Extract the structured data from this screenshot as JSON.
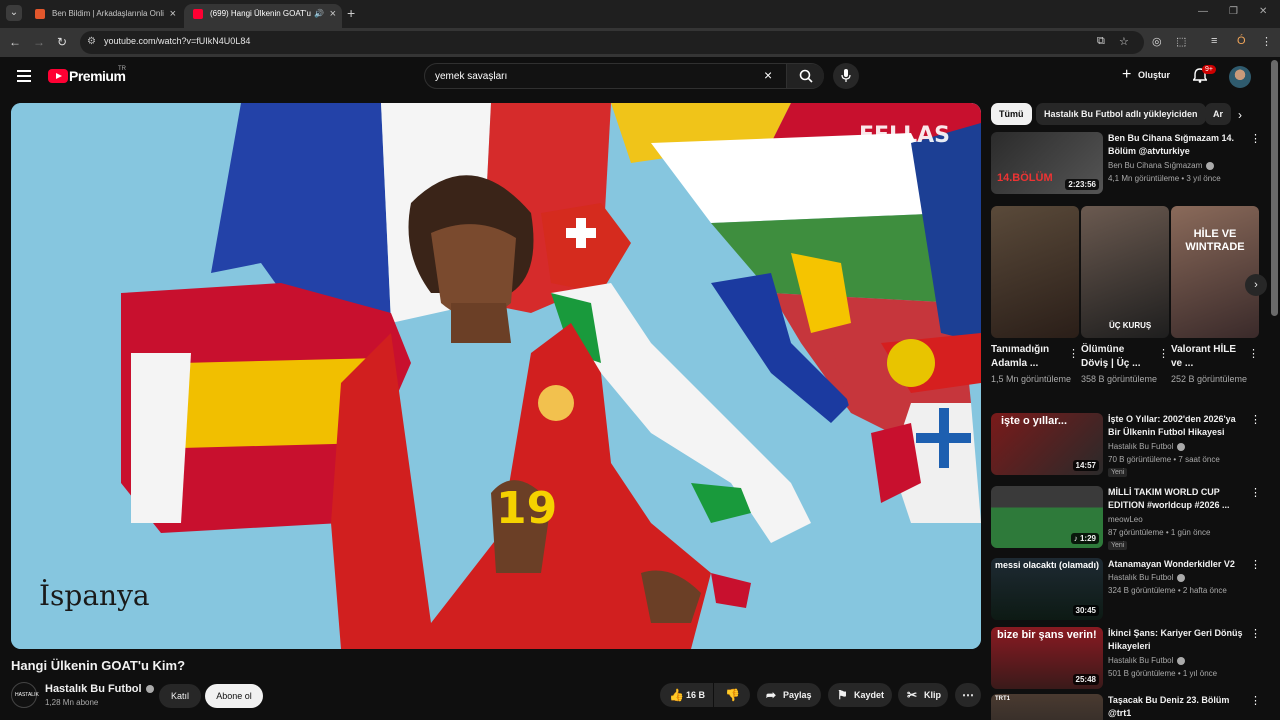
{
  "browser": {
    "tabs": [
      {
        "title": "Ben Bildim | Arkadaşlarınla Onli",
        "active": false
      },
      {
        "title": "(699) Hangi Ülkenin GOAT'u",
        "active": true
      }
    ],
    "url": "youtube.com/watch?v=fUIkN4U0L84",
    "profile_letter": "Ó"
  },
  "header": {
    "brand": "Premium",
    "country_code": "TR",
    "search_value": "yemek savaşları",
    "create_label": "Oluştur",
    "notification_count": "9+"
  },
  "video": {
    "overlay_caption": "İspanya",
    "watermark": "FELLAS",
    "title": "Hangi Ülkenin GOAT'u Kim?",
    "channel": "Hastalık Bu Futbol",
    "channel_avatar_text": "HASTALIK",
    "subscribers": "1,28 Mn abone",
    "join_label": "Katıl",
    "subscribe_label": "Abone ol",
    "likes": "16 B",
    "share_label": "Paylaş",
    "save_label": "Kaydet",
    "clip_label": "Klip"
  },
  "sidebar": {
    "chips": [
      "Tümü",
      "Hastalık Bu Futbol adlı yükleyiciden",
      "Ar"
    ],
    "first": {
      "title": "Ben Bu Cihana Sığmazam 14. Bölüm @atvturkiye",
      "channel": "Ben Bu Cihana Sığmazam",
      "meta": "4,1 Mn görüntüleme • 3 yıl önce",
      "duration": "2:23:56",
      "thumb_text": "14.BÖLÜM"
    },
    "shorts": [
      {
        "title": "Tanımadığın Adamla ...",
        "views": "1,5 Mn görüntüleme",
        "thumb_text": ""
      },
      {
        "title": "Ölümüne Döviş | Üç ...",
        "views": "358 B görüntüleme",
        "thumb_text": "ÜÇ KURUŞ"
      },
      {
        "title": "Valorant HİLE ve ...",
        "views": "252 B görüntüleme",
        "thumb_text": "HİLE VE WINTRADE"
      }
    ],
    "videos": [
      {
        "title": "İşte O Yıllar: 2002'den 2026'ya Bir Ülkenin Futbol Hikayesi",
        "channel": "Hastalık Bu Futbol",
        "meta": "70 B görüntüleme • 7 saat önce",
        "new": "Yeni",
        "duration": "14:57",
        "thumb_text": "işte o yıllar..."
      },
      {
        "title": "MİLLİ TAKIM WORLD CUP EDITION #worldcup #2026 ...",
        "channel": "meowLeo",
        "meta": "87 görüntüleme • 1 gün önce",
        "new": "Yeni",
        "duration": "1:29",
        "thumb_text": ""
      },
      {
        "title": "Atanamayan Wonderkidler V2",
        "channel": "Hastalık Bu Futbol",
        "meta": "324 B görüntüleme • 2 hafta önce",
        "new": "",
        "duration": "30:45",
        "thumb_text": "messi olacaktı (olamadı)"
      },
      {
        "title": "İkinci Şans: Kariyer Geri Dönüş Hikayeleri",
        "channel": "Hastalık Bu Futbol",
        "meta": "501 B görüntüleme • 1 yıl önce",
        "new": "",
        "duration": "25:48",
        "thumb_text": "bize bir şans verin!"
      },
      {
        "title": "Taşacak Bu Deniz 23. Bölüm @trt1",
        "channel": "",
        "meta": "",
        "new": "",
        "duration": "",
        "thumb_text": "TRT1"
      }
    ]
  },
  "colors": {
    "accent": "#ff0033",
    "background": "#0f0f0f",
    "surface": "#272727"
  }
}
